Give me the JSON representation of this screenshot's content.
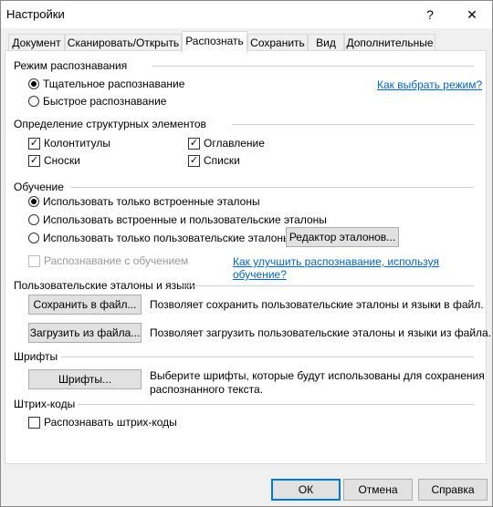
{
  "window": {
    "title": "Настройки",
    "help_glyph": "?",
    "close_glyph": "✕"
  },
  "tabs": [
    {
      "label": "Документ"
    },
    {
      "label": "Сканировать/Открыть"
    },
    {
      "label": "Распознать",
      "active": true
    },
    {
      "label": "Сохранить"
    },
    {
      "label": "Вид"
    },
    {
      "label": "Дополнительные"
    }
  ],
  "recognition_mode": {
    "heading": "Режим распознавания",
    "options": [
      {
        "label": "Тщательное распознавание",
        "selected": true
      },
      {
        "label": "Быстрое распознавание",
        "selected": false
      }
    ],
    "help_link": "Как выбрать режим?"
  },
  "structure": {
    "heading": "Определение структурных элементов",
    "items": [
      {
        "label": "Колонтитулы",
        "checked": true
      },
      {
        "label": "Оглавление",
        "checked": true
      },
      {
        "label": "Сноски",
        "checked": true
      },
      {
        "label": "Списки",
        "checked": true
      }
    ]
  },
  "training": {
    "heading": "Обучение",
    "options": [
      {
        "label": "Использовать только встроенные эталоны",
        "selected": true
      },
      {
        "label": "Использовать встроенные и пользовательские эталоны",
        "selected": false
      },
      {
        "label": "Использовать только пользовательские эталоны",
        "selected": false
      }
    ],
    "editor_button": "Редактор эталонов...",
    "train_checkbox": {
      "label": "Распознавание с обучением",
      "checked": false,
      "enabled": false
    },
    "help_link": "Как улучшить распознавание, используя обучение?"
  },
  "user_patterns": {
    "heading": "Пользовательские эталоны и языки",
    "save_button": "Сохранить в файл...",
    "save_desc": "Позволяет сохранить пользовательские эталоны и языки в файл.",
    "load_button": "Загрузить из файла...",
    "load_desc": "Позволяет загрузить пользовательские эталоны и языки из файла."
  },
  "fonts": {
    "heading": "Шрифты",
    "button": "Шрифты...",
    "desc_line1": "Выберите шрифты, которые будут использованы для сохранения",
    "desc_line2": "распознанного текста."
  },
  "barcodes": {
    "heading": "Штрих-коды",
    "checkbox": {
      "label": "Распознавать штрих-коды",
      "checked": false
    }
  },
  "footer": {
    "ok": "ОК",
    "cancel": "Отмена",
    "help": "Справка"
  },
  "colors": {
    "link": "#0066cc",
    "default_button_border": "#0078d7"
  }
}
